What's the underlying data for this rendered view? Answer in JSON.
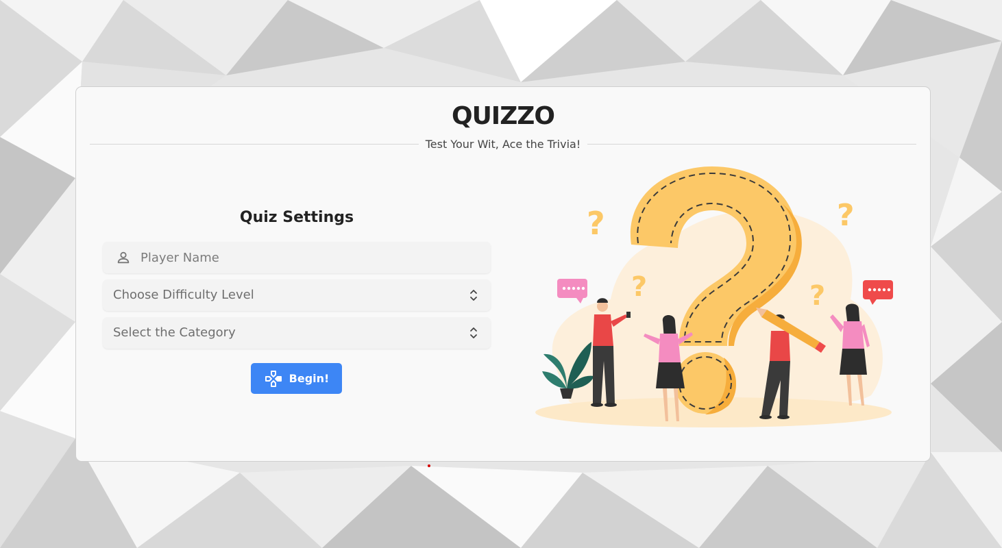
{
  "app": {
    "title": "QUIZZO",
    "tagline": "Test Your Wit, Ace the Trivia!"
  },
  "settings": {
    "heading": "Quiz Settings",
    "player_name": {
      "placeholder": "Player Name",
      "value": "",
      "icon": "user-icon"
    },
    "difficulty": {
      "selected_label": "Choose Difficulty Level",
      "icon": "chevron-up-down-icon"
    },
    "category": {
      "selected_label": "Select the Category",
      "icon": "chevron-up-down-icon"
    },
    "begin_button": {
      "label": "Begin!",
      "icon": "gamepad-icon"
    }
  },
  "colors": {
    "accent": "#3d86f5",
    "card_background": "#f9f9f9",
    "question_mark": "#fcc867",
    "question_mark_shadow": "#f6ad3c"
  }
}
